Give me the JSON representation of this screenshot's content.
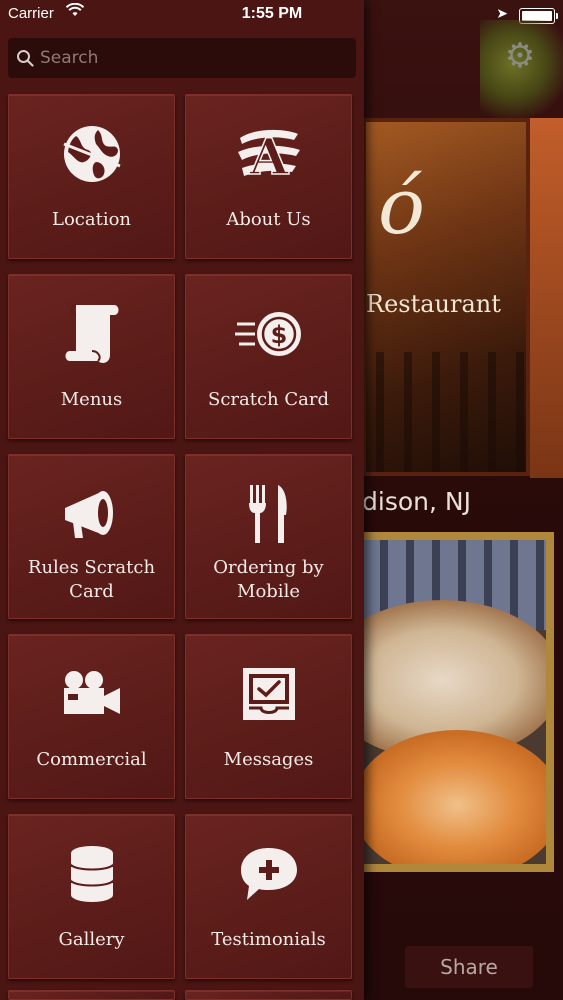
{
  "status_bar": {
    "carrier": "Carrier",
    "time": "1:55 PM"
  },
  "search": {
    "placeholder": "Search"
  },
  "menu_tiles": [
    {
      "label": "Location",
      "icon": "globe-icon"
    },
    {
      "label": "About Us",
      "icon": "about-letter-icon"
    },
    {
      "label": "Menus",
      "icon": "scroll-icon"
    },
    {
      "label": "Scratch Card",
      "icon": "dollar-coin-icon"
    },
    {
      "label": "Rules Scratch Card",
      "icon": "megaphone-icon"
    },
    {
      "label": "Ordering by Mobile",
      "icon": "fork-knife-icon"
    },
    {
      "label": "Commercial",
      "icon": "video-camera-icon"
    },
    {
      "label": "Messages",
      "icon": "inbox-check-icon"
    },
    {
      "label": "Gallery",
      "icon": "database-stack-icon"
    },
    {
      "label": "Testimonials",
      "icon": "chat-bubble-plus-icon"
    }
  ],
  "background_page": {
    "subtitle": "Restaurant",
    "city": "dison, NJ",
    "share_label": "Share"
  },
  "colors": {
    "drawer_bg": "#4a1512",
    "tile_bg": "#5c1d1a",
    "search_bg": "#2b0c0a",
    "label_text": "#f3ebe8"
  }
}
